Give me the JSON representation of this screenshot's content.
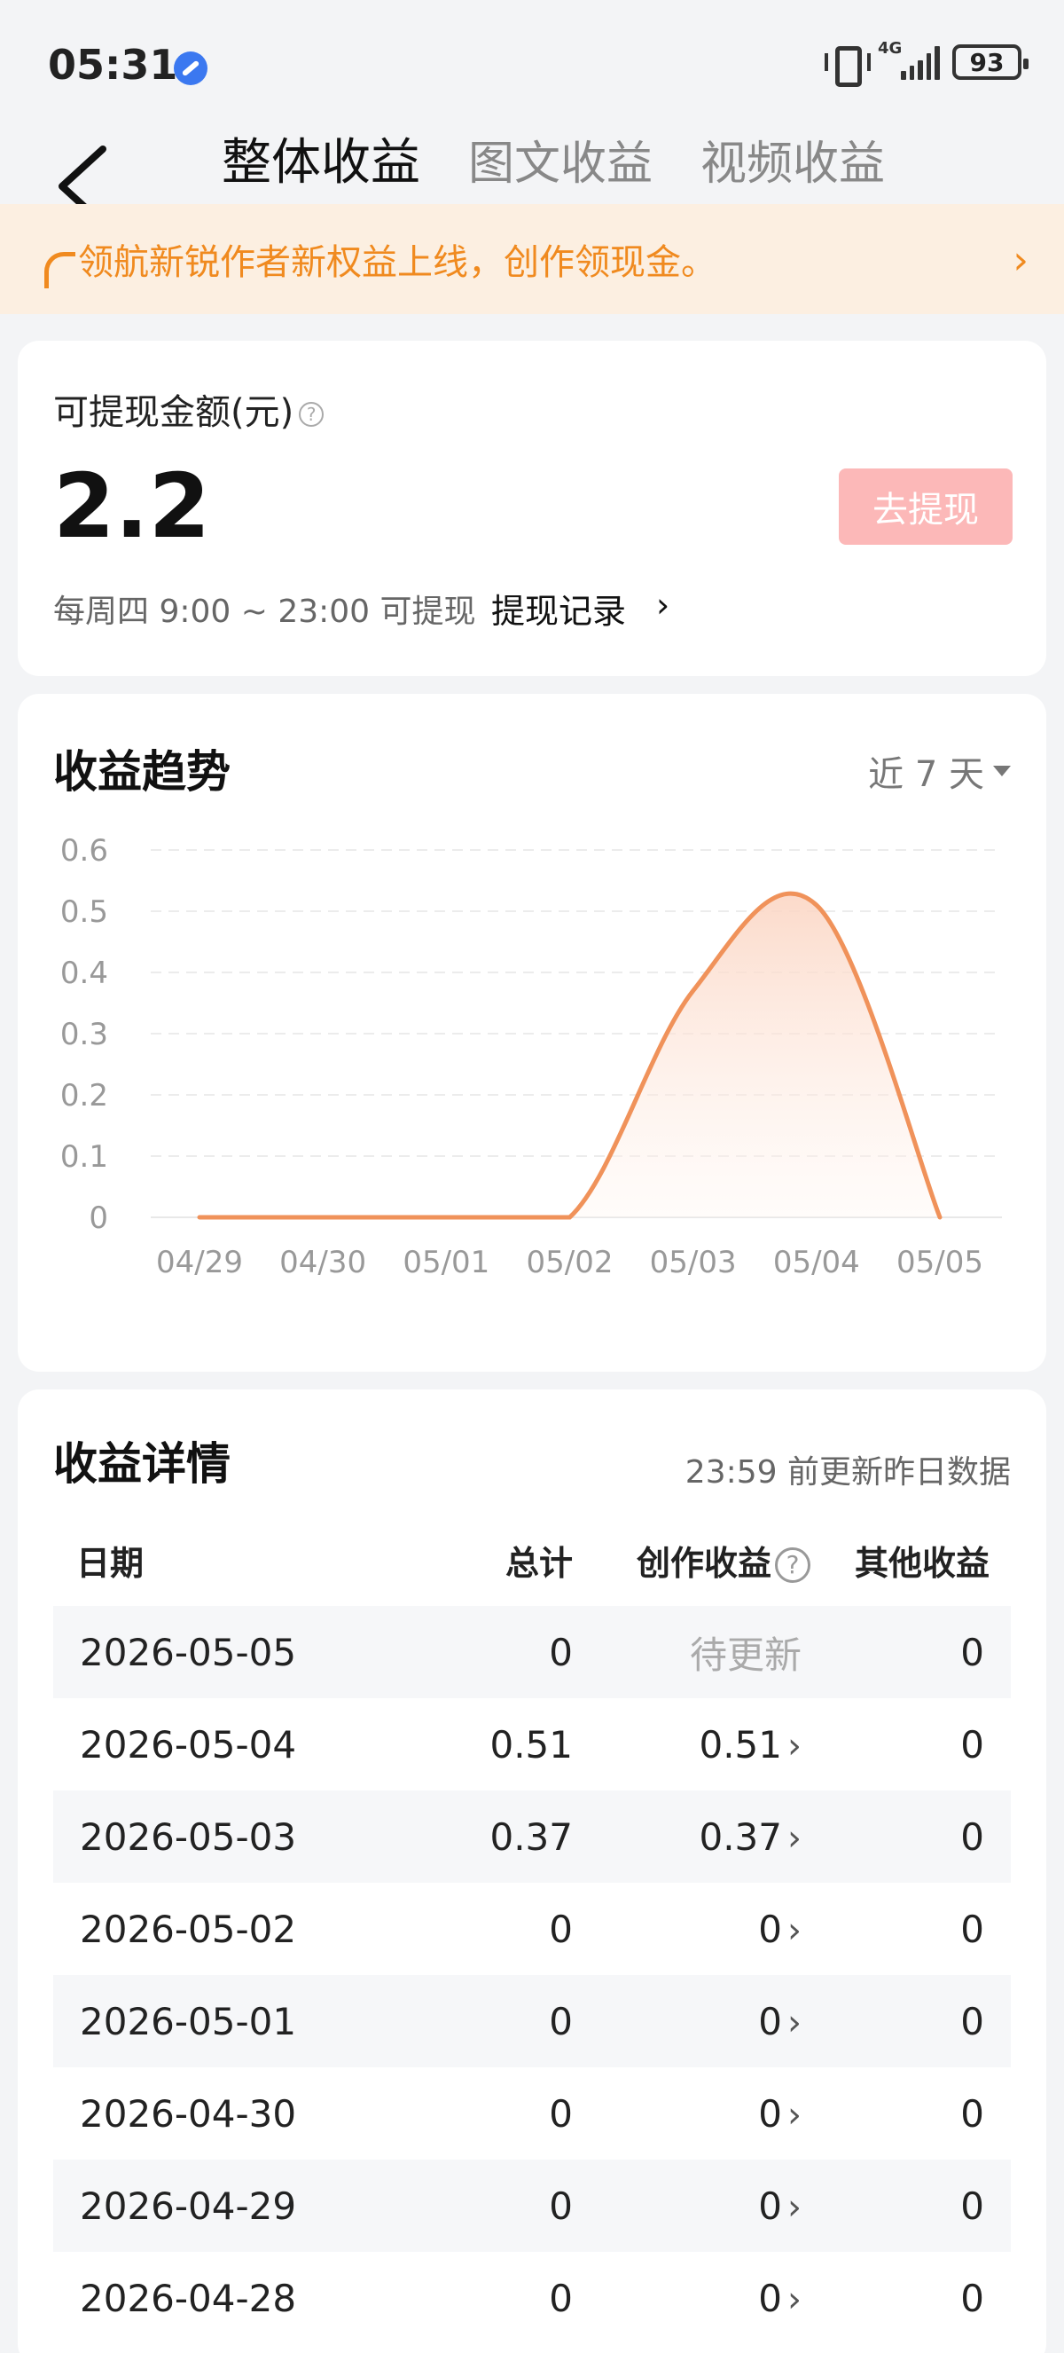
{
  "status_bar": {
    "time": "05:31",
    "network": "4G",
    "battery": "93"
  },
  "header": {
    "tabs": [
      {
        "label": "整体收益",
        "active": true
      },
      {
        "label": "图文收益",
        "active": false
      },
      {
        "label": "视频收益",
        "active": false
      }
    ]
  },
  "banner": {
    "text": "领航新锐作者新权益上线，创作领现金。"
  },
  "withdraw": {
    "label": "可提现金额(元)",
    "amount": "2.2",
    "button": "去提现",
    "time_text": "每周四 9:00 ~ 23:00 可提现",
    "record_link": "提现记录"
  },
  "trend": {
    "title": "收益趋势",
    "range": "近 7 天"
  },
  "chart_data": {
    "type": "area",
    "x": [
      "04/29",
      "04/30",
      "05/01",
      "05/02",
      "05/03",
      "05/04",
      "05/05"
    ],
    "series": [
      {
        "values": [
          0,
          0,
          0,
          0,
          0.37,
          0.51,
          0
        ]
      }
    ],
    "yticks": [
      "0",
      "0.1",
      "0.2",
      "0.3",
      "0.4",
      "0.5",
      "0.6"
    ],
    "ylim": [
      0,
      0.6
    ],
    "grid": true,
    "color": "#f0925a"
  },
  "detail": {
    "title": "收益详情",
    "subtitle": "23:59 前更新昨日数据",
    "columns": [
      "日期",
      "总计",
      "创作收益",
      "其他收益"
    ],
    "rows": [
      {
        "date": "2026-05-05",
        "total": "0",
        "create": "待更新",
        "other": "0"
      },
      {
        "date": "2026-05-04",
        "total": "0.51",
        "create": "0.51",
        "other": "0"
      },
      {
        "date": "2026-05-03",
        "total": "0.37",
        "create": "0.37",
        "other": "0"
      },
      {
        "date": "2026-05-02",
        "total": "0",
        "create": "0",
        "other": "0"
      },
      {
        "date": "2026-05-01",
        "total": "0",
        "create": "0",
        "other": "0"
      },
      {
        "date": "2026-04-30",
        "total": "0",
        "create": "0",
        "other": "0"
      },
      {
        "date": "2026-04-29",
        "total": "0",
        "create": "0",
        "other": "0"
      },
      {
        "date": "2026-04-28",
        "total": "0",
        "create": "0",
        "other": "0"
      }
    ]
  }
}
